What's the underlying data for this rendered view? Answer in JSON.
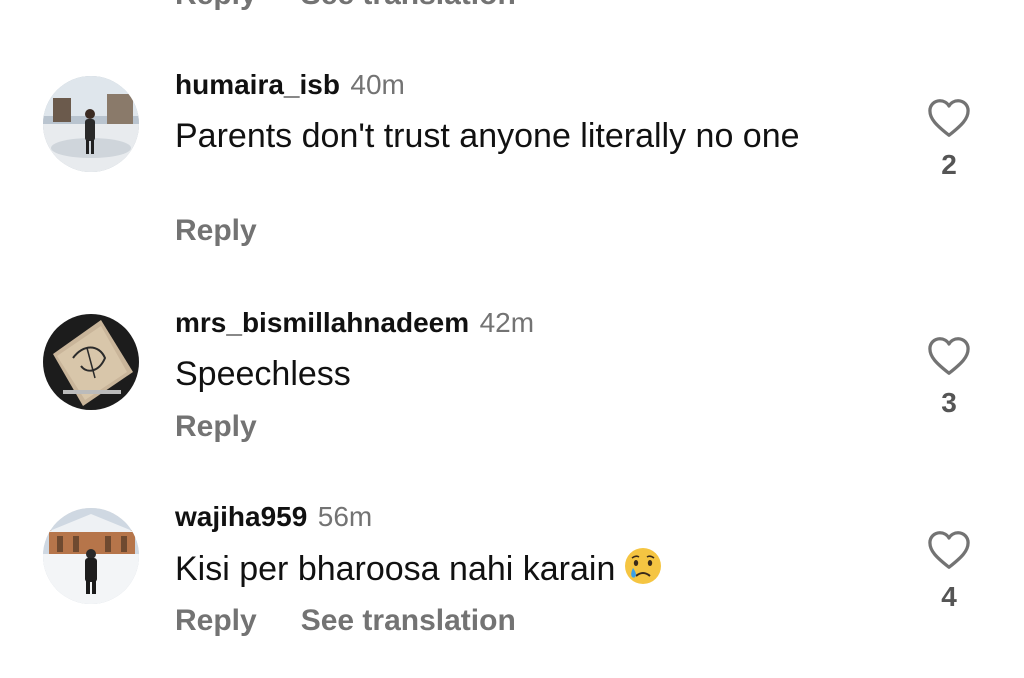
{
  "top_partial": {
    "reply_label": "Reply",
    "translate_label": "See translation"
  },
  "comments": [
    {
      "username": "humaira_isb",
      "time": "40m",
      "text": "Parents don't trust anyone literally no one",
      "reply_label": "Reply",
      "likes": "2"
    },
    {
      "username": "mrs_bismillahnadeem",
      "time": "42m",
      "text": "Speechless",
      "reply_label": "Reply",
      "likes": "3"
    },
    {
      "username": "wajiha959",
      "time": "56m",
      "text": "Kisi per bharoosa nahi karain",
      "emoji": "crying-face-emoji",
      "reply_label": "Reply",
      "translate_label": "See translation",
      "likes": "4"
    }
  ],
  "icons": {
    "like": "heart-outline-icon"
  },
  "colors": {
    "text": "#111111",
    "muted": "#737373",
    "emoji_face": "#f5c542",
    "emoji_tear": "#3aa0e8"
  }
}
